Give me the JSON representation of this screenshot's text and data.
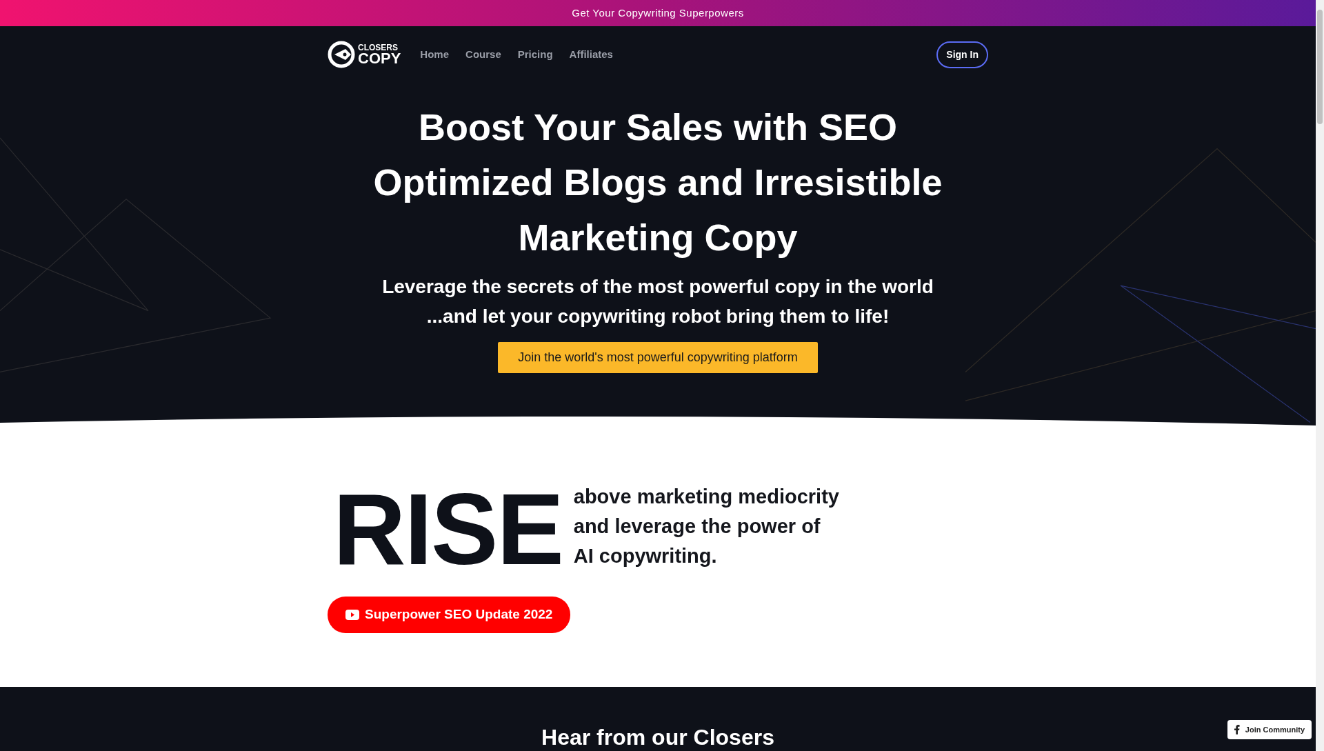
{
  "banner": {
    "text": "Get Your Copywriting Superpowers"
  },
  "nav": {
    "logo": {
      "top": "CLOSERS",
      "bottom": "COPY"
    },
    "links": [
      {
        "label": "Home"
      },
      {
        "label": "Course"
      },
      {
        "label": "Pricing"
      },
      {
        "label": "Affiliates"
      }
    ],
    "sign_in": "Sign In"
  },
  "hero": {
    "title": "Boost Your Sales with SEO Optimized Blogs and Irresistible Marketing Copy",
    "subtitle_lines": [
      "Leverage the secrets of the most powerful copy in the world",
      "...and let your copywriting robot bring them to life!"
    ],
    "cta": "Join the world's most powerful copywriting platform"
  },
  "rise": {
    "word": "RISE",
    "lines": [
      "above marketing mediocrity",
      "and leverage the power of",
      "AI copywriting."
    ],
    "video_button": "Superpower SEO Update 2022"
  },
  "testimonials": {
    "heading": "Hear from our Closers"
  },
  "community_button": "Join Community"
}
